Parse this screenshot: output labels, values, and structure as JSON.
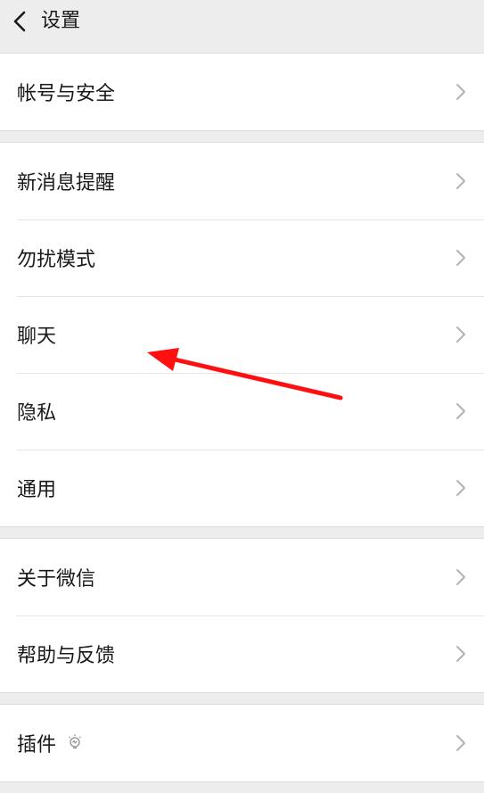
{
  "header": {
    "title": "设置"
  },
  "groups": [
    {
      "items": [
        {
          "label": "帐号与安全"
        }
      ]
    },
    {
      "items": [
        {
          "label": "新消息提醒"
        },
        {
          "label": "勿扰模式"
        },
        {
          "label": "聊天"
        },
        {
          "label": "隐私"
        },
        {
          "label": "通用"
        }
      ]
    },
    {
      "items": [
        {
          "label": "关于微信"
        },
        {
          "label": "帮助与反馈"
        }
      ]
    },
    {
      "items": [
        {
          "label": "插件"
        }
      ]
    }
  ],
  "colors": {
    "background": "#ededed",
    "row_background": "#ffffff",
    "text": "#191919",
    "chevron": "#b2b2b2",
    "annotation_arrow": "#ff1010"
  },
  "icons": {
    "back": "chevron-left-icon",
    "row_arrow": "chevron-right-icon",
    "plugin": "lightbulb-icon"
  }
}
